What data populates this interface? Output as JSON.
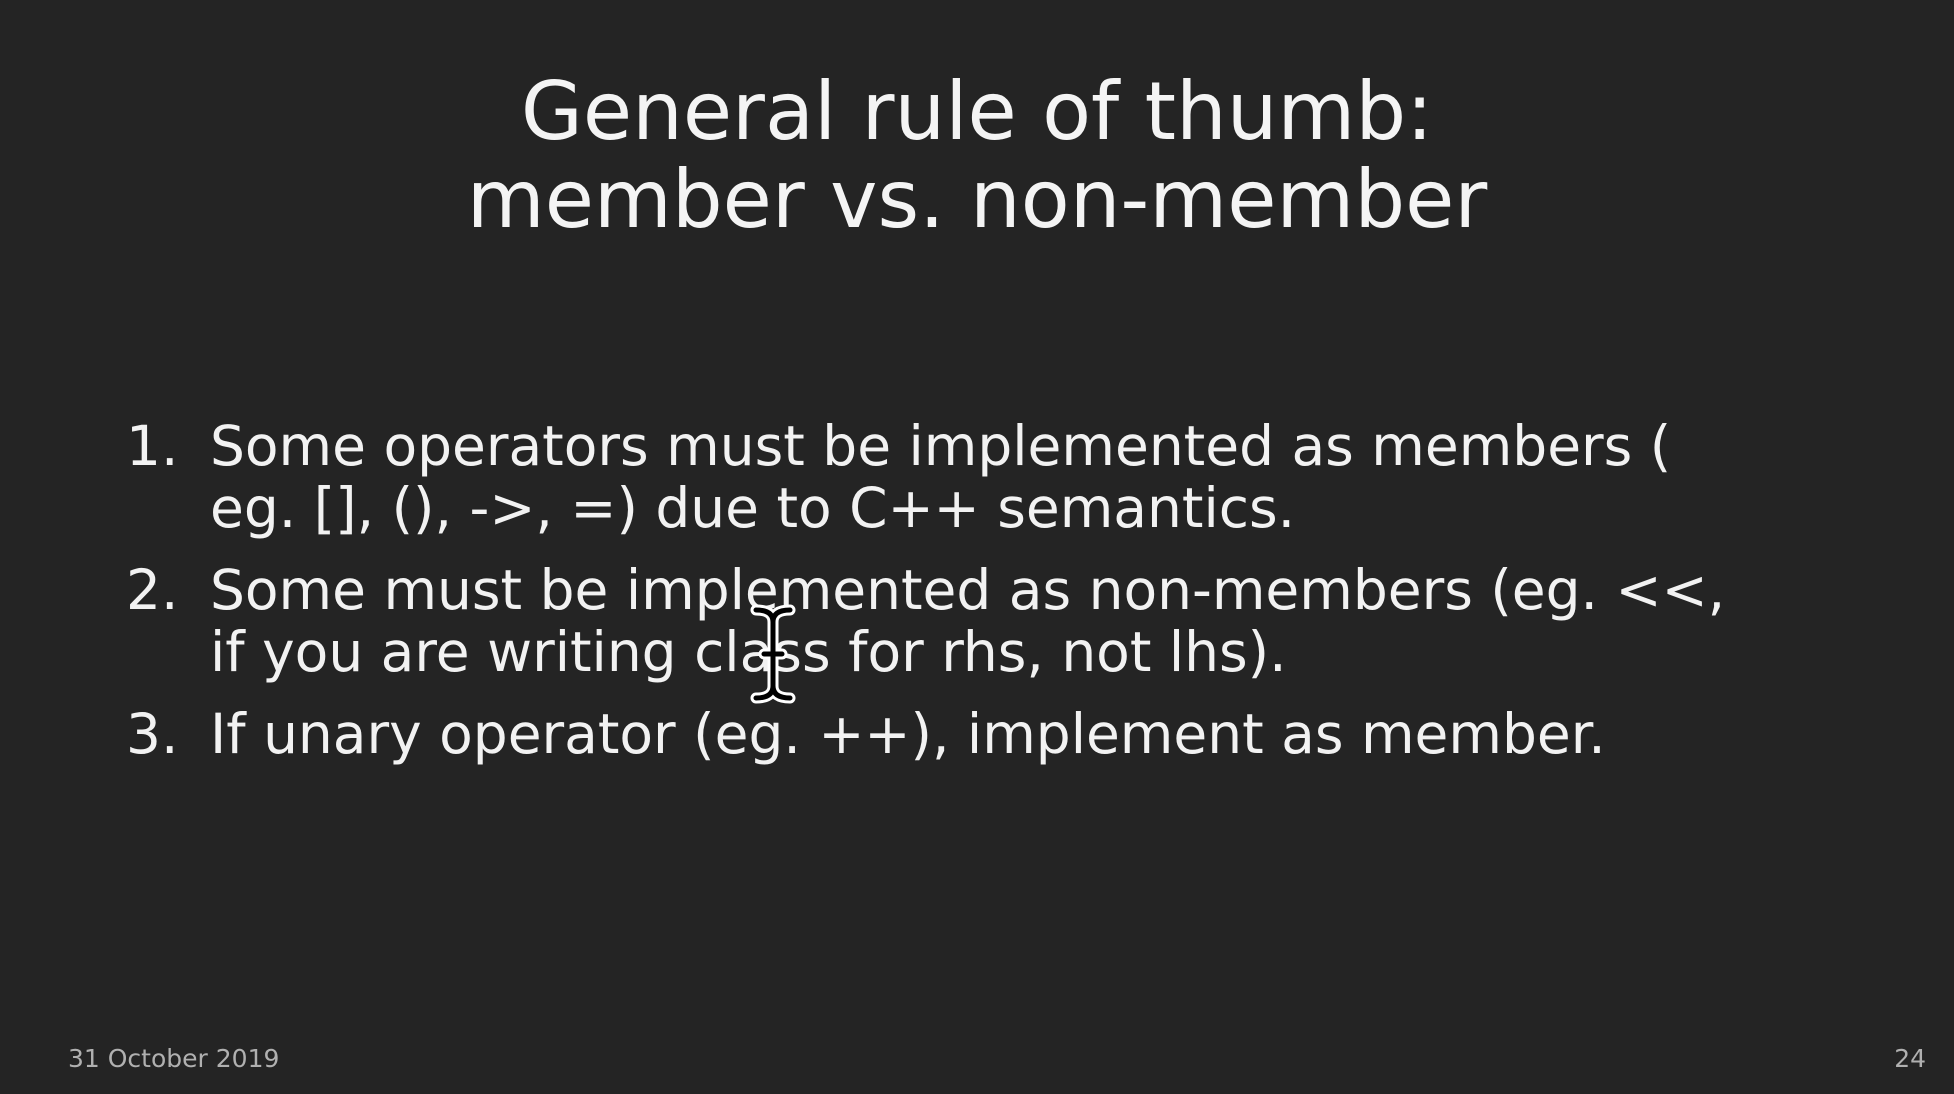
{
  "slide": {
    "title_line1": "General rule of thumb:",
    "title_line2": "member vs. non-member",
    "items": [
      {
        "number": "1.",
        "line1": "Some operators must be implemented as members (",
        "line2": "eg. [], (), ->, =) due to C++ semantics."
      },
      {
        "number": "2.",
        "line1": "Some must be implemented as non-members (eg. <<,",
        "line2": "if you are writing class for rhs, not lhs)."
      },
      {
        "number": "3.",
        "line1": "If unary operator (eg. ++), implement as member."
      }
    ],
    "footer_date": "31 October 2019",
    "page_number": "24"
  },
  "cursor": {
    "icon": "text-cursor-icon"
  }
}
